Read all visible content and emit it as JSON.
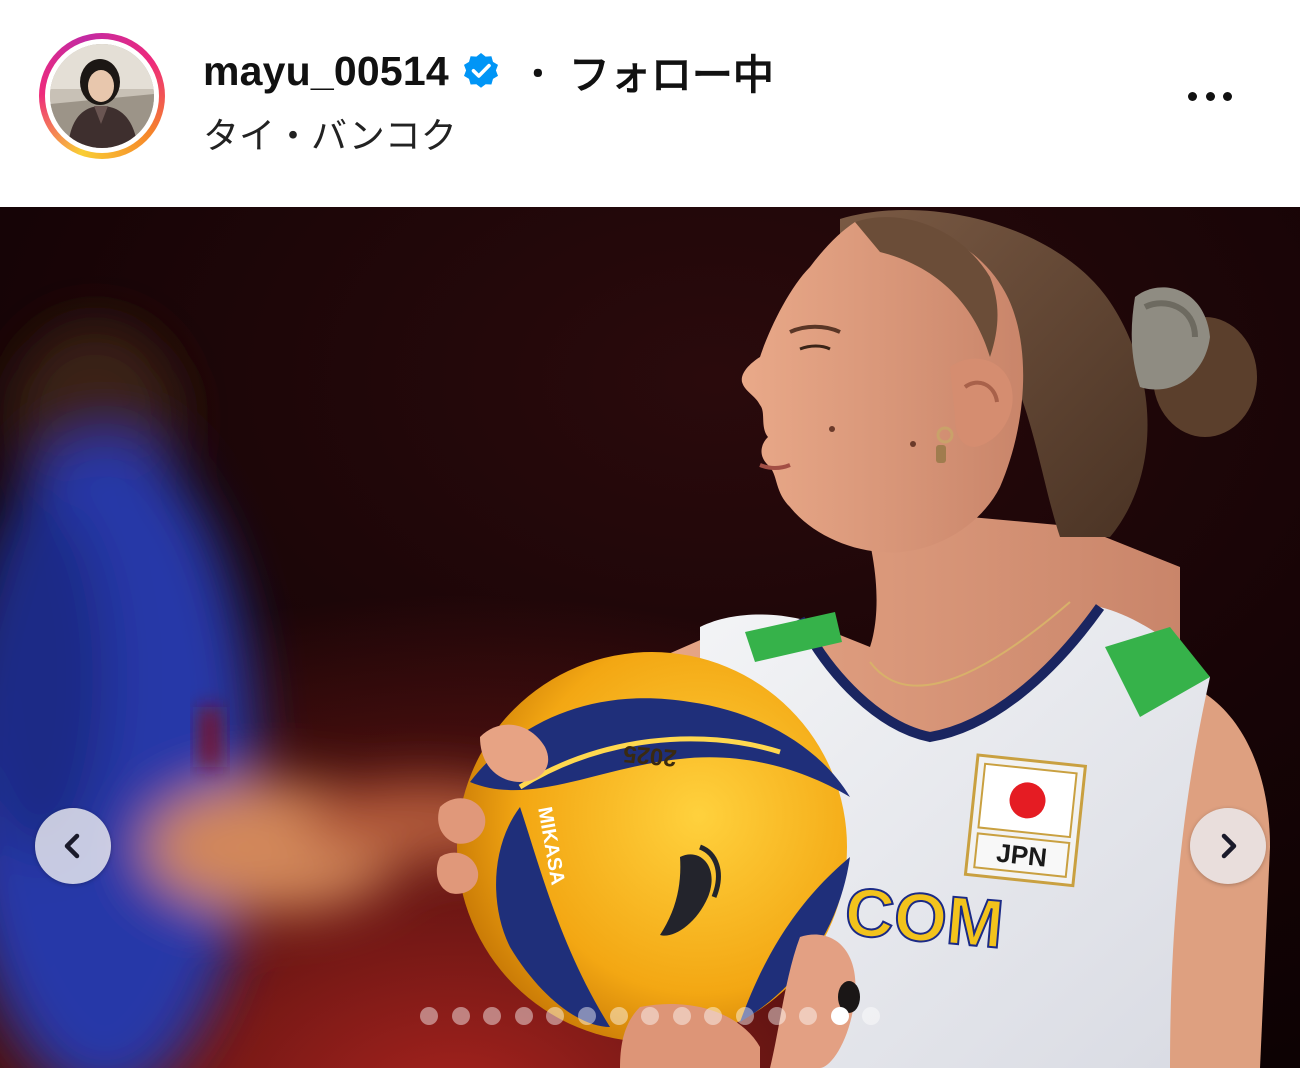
{
  "post_header": {
    "username": "mayu_00514",
    "verified": true,
    "separator": "・",
    "follow_state": "フォロー中",
    "location": "タイ・バンコク",
    "more_icon": "more-horizontal-icon"
  },
  "carousel": {
    "prev_icon": "chevron-left-icon",
    "next_icon": "chevron-right-icon",
    "total_slides": 15,
    "active_index": 13
  },
  "photo_text": {
    "flag_country": "JPN",
    "jersey_sponsor": "COM",
    "ball_year": "2025",
    "ball_brand": "MIKASA"
  },
  "colors": {
    "verified_badge": "#0095f6",
    "photo_background": "#1a0608",
    "ball_yellow": "#f7b21a",
    "ball_blue": "#1f2f7a",
    "jersey_accent_green": "#36b24a"
  }
}
